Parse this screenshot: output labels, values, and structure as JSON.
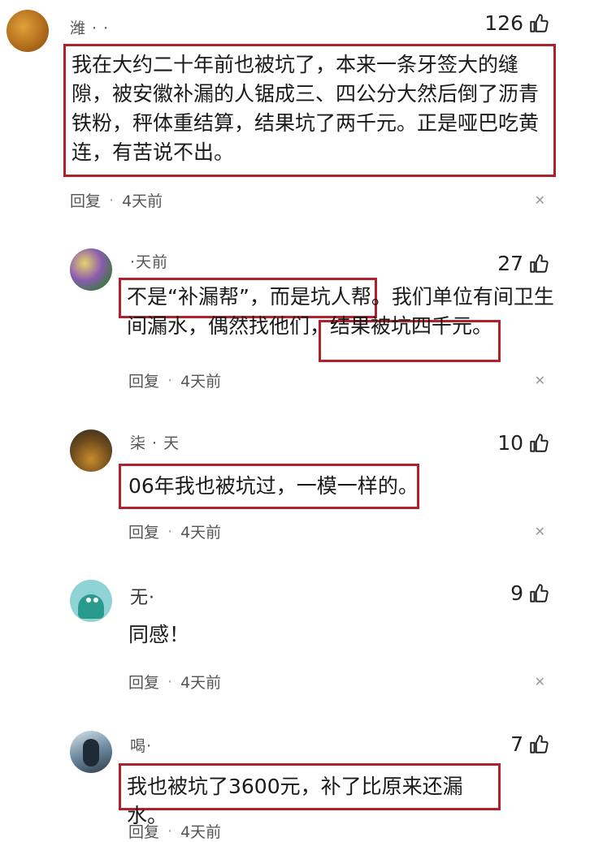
{
  "comments": [
    {
      "username": "潍 · ·",
      "likes": "126",
      "text": "我在大约二十年前也被坑了，本来一条牙签大的缝隙，被安徽补漏的人锯成三、四公分大然后倒了沥青铁粉，秤体重结算，结果坑了两千元。正是哑巴吃黄连，有苦说不出。",
      "reply_label": "回复",
      "time": "4天前"
    },
    {
      "username": "·天前",
      "likes": "27",
      "text_part1": "不是“补漏帮”，而是坑人帮。",
      "text_part2": "我们单位有间卫生间漏水，偶然找他们，",
      "text_part3": "结果被坑四千元。",
      "reply_label": "回复",
      "time": "4天前"
    },
    {
      "username": "柒 · 天",
      "likes": "10",
      "text": "06年我也被坑过，一模一样的。",
      "reply_label": "回复",
      "time": "4天前"
    },
    {
      "username": "无·",
      "likes": "9",
      "text": "同感！",
      "reply_label": "回复",
      "time": "4天前"
    },
    {
      "username": "喝·",
      "likes": "7",
      "text": "我也被坑了3600元，补了比原来还漏水。",
      "reply_label": "回复",
      "time": "4天前"
    }
  ],
  "colors": {
    "highlight_border": "#b0222b"
  },
  "icons": {
    "like": "thumbs-up-icon",
    "close": "close-icon"
  }
}
